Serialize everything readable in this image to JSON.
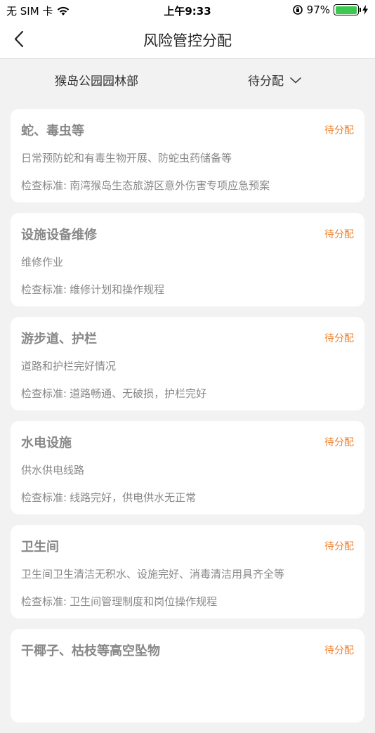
{
  "status_bar": {
    "carrier": "无 SIM 卡",
    "time": "上午9:33",
    "battery": "97%",
    "battery_level": 0.97
  },
  "nav": {
    "title": "风险管控分配",
    "back_icon": "chevron-left-icon"
  },
  "filters": {
    "department": "猴岛公园园林部",
    "status": "待分配"
  },
  "colors": {
    "status_accent": "#f07f2b",
    "battery_green": "#3cc94f"
  },
  "standard_prefix": "检查标准:",
  "items": [
    {
      "title": "蛇、毒虫等",
      "status": "待分配",
      "desc": "日常预防蛇和有毒生物开展、防蛇虫药储备等",
      "standard": "南湾猴岛生态旅游区意外伤害专项应急预案"
    },
    {
      "title": "设施设备维修",
      "status": "待分配",
      "desc": "维修作业",
      "standard": "维修计划和操作规程"
    },
    {
      "title": "游步道、护栏",
      "status": "待分配",
      "desc": "道路和护栏完好情况",
      "standard": "道路畅通、无破损，护栏完好"
    },
    {
      "title": "水电设施",
      "status": "待分配",
      "desc": "供水供电线路",
      "standard": "线路完好，供电供水无正常"
    },
    {
      "title": "卫生间",
      "status": "待分配",
      "desc": "卫生间卫生清洁无积水、设施完好、消毒清洁用具齐全等",
      "standard": "卫生间管理制度和岗位操作规程"
    },
    {
      "title": "干椰子、枯枝等高空坠物",
      "status": "待分配",
      "desc": "",
      "standard": ""
    }
  ]
}
